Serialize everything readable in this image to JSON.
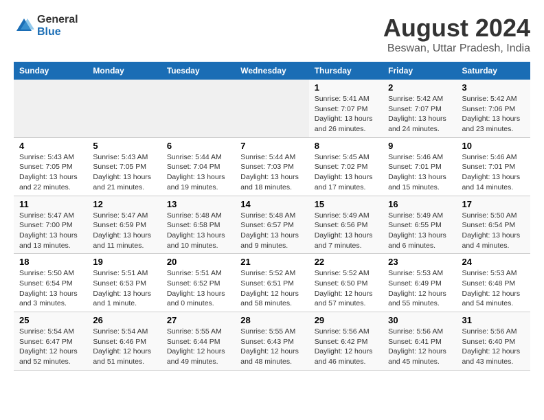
{
  "logo": {
    "general": "General",
    "blue": "Blue"
  },
  "title": "August 2024",
  "subtitle": "Beswan, Uttar Pradesh, India",
  "days_of_week": [
    "Sunday",
    "Monday",
    "Tuesday",
    "Wednesday",
    "Thursday",
    "Friday",
    "Saturday"
  ],
  "weeks": [
    [
      {
        "day": "",
        "detail": ""
      },
      {
        "day": "",
        "detail": ""
      },
      {
        "day": "",
        "detail": ""
      },
      {
        "day": "",
        "detail": ""
      },
      {
        "day": "1",
        "detail": "Sunrise: 5:41 AM\nSunset: 7:07 PM\nDaylight: 13 hours\nand 26 minutes."
      },
      {
        "day": "2",
        "detail": "Sunrise: 5:42 AM\nSunset: 7:07 PM\nDaylight: 13 hours\nand 24 minutes."
      },
      {
        "day": "3",
        "detail": "Sunrise: 5:42 AM\nSunset: 7:06 PM\nDaylight: 13 hours\nand 23 minutes."
      }
    ],
    [
      {
        "day": "4",
        "detail": "Sunrise: 5:43 AM\nSunset: 7:05 PM\nDaylight: 13 hours\nand 22 minutes."
      },
      {
        "day": "5",
        "detail": "Sunrise: 5:43 AM\nSunset: 7:05 PM\nDaylight: 13 hours\nand 21 minutes."
      },
      {
        "day": "6",
        "detail": "Sunrise: 5:44 AM\nSunset: 7:04 PM\nDaylight: 13 hours\nand 19 minutes."
      },
      {
        "day": "7",
        "detail": "Sunrise: 5:44 AM\nSunset: 7:03 PM\nDaylight: 13 hours\nand 18 minutes."
      },
      {
        "day": "8",
        "detail": "Sunrise: 5:45 AM\nSunset: 7:02 PM\nDaylight: 13 hours\nand 17 minutes."
      },
      {
        "day": "9",
        "detail": "Sunrise: 5:46 AM\nSunset: 7:01 PM\nDaylight: 13 hours\nand 15 minutes."
      },
      {
        "day": "10",
        "detail": "Sunrise: 5:46 AM\nSunset: 7:01 PM\nDaylight: 13 hours\nand 14 minutes."
      }
    ],
    [
      {
        "day": "11",
        "detail": "Sunrise: 5:47 AM\nSunset: 7:00 PM\nDaylight: 13 hours\nand 13 minutes."
      },
      {
        "day": "12",
        "detail": "Sunrise: 5:47 AM\nSunset: 6:59 PM\nDaylight: 13 hours\nand 11 minutes."
      },
      {
        "day": "13",
        "detail": "Sunrise: 5:48 AM\nSunset: 6:58 PM\nDaylight: 13 hours\nand 10 minutes."
      },
      {
        "day": "14",
        "detail": "Sunrise: 5:48 AM\nSunset: 6:57 PM\nDaylight: 13 hours\nand 9 minutes."
      },
      {
        "day": "15",
        "detail": "Sunrise: 5:49 AM\nSunset: 6:56 PM\nDaylight: 13 hours\nand 7 minutes."
      },
      {
        "day": "16",
        "detail": "Sunrise: 5:49 AM\nSunset: 6:55 PM\nDaylight: 13 hours\nand 6 minutes."
      },
      {
        "day": "17",
        "detail": "Sunrise: 5:50 AM\nSunset: 6:54 PM\nDaylight: 13 hours\nand 4 minutes."
      }
    ],
    [
      {
        "day": "18",
        "detail": "Sunrise: 5:50 AM\nSunset: 6:54 PM\nDaylight: 13 hours\nand 3 minutes."
      },
      {
        "day": "19",
        "detail": "Sunrise: 5:51 AM\nSunset: 6:53 PM\nDaylight: 13 hours\nand 1 minute."
      },
      {
        "day": "20",
        "detail": "Sunrise: 5:51 AM\nSunset: 6:52 PM\nDaylight: 13 hours\nand 0 minutes."
      },
      {
        "day": "21",
        "detail": "Sunrise: 5:52 AM\nSunset: 6:51 PM\nDaylight: 12 hours\nand 58 minutes."
      },
      {
        "day": "22",
        "detail": "Sunrise: 5:52 AM\nSunset: 6:50 PM\nDaylight: 12 hours\nand 57 minutes."
      },
      {
        "day": "23",
        "detail": "Sunrise: 5:53 AM\nSunset: 6:49 PM\nDaylight: 12 hours\nand 55 minutes."
      },
      {
        "day": "24",
        "detail": "Sunrise: 5:53 AM\nSunset: 6:48 PM\nDaylight: 12 hours\nand 54 minutes."
      }
    ],
    [
      {
        "day": "25",
        "detail": "Sunrise: 5:54 AM\nSunset: 6:47 PM\nDaylight: 12 hours\nand 52 minutes."
      },
      {
        "day": "26",
        "detail": "Sunrise: 5:54 AM\nSunset: 6:46 PM\nDaylight: 12 hours\nand 51 minutes."
      },
      {
        "day": "27",
        "detail": "Sunrise: 5:55 AM\nSunset: 6:44 PM\nDaylight: 12 hours\nand 49 minutes."
      },
      {
        "day": "28",
        "detail": "Sunrise: 5:55 AM\nSunset: 6:43 PM\nDaylight: 12 hours\nand 48 minutes."
      },
      {
        "day": "29",
        "detail": "Sunrise: 5:56 AM\nSunset: 6:42 PM\nDaylight: 12 hours\nand 46 minutes."
      },
      {
        "day": "30",
        "detail": "Sunrise: 5:56 AM\nSunset: 6:41 PM\nDaylight: 12 hours\nand 45 minutes."
      },
      {
        "day": "31",
        "detail": "Sunrise: 5:56 AM\nSunset: 6:40 PM\nDaylight: 12 hours\nand 43 minutes."
      }
    ]
  ]
}
